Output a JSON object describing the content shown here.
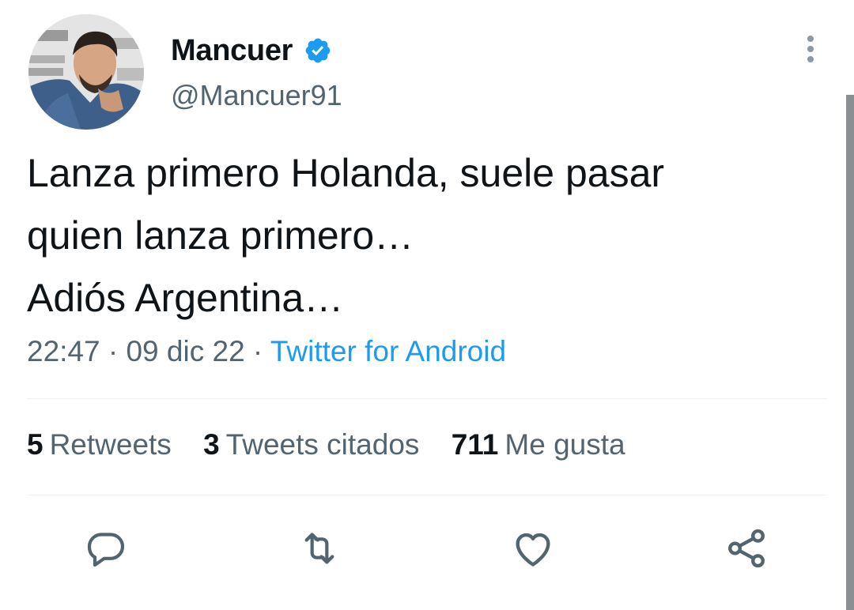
{
  "tweet": {
    "author": {
      "display_name": "Mancuer",
      "handle": "@Mancuer91",
      "verified": true,
      "avatar": "profile-photo"
    },
    "text_lines": [
      "Lanza primero Holanda, suele pasar",
      "quien lanza primero…",
      "Adiós Argentina…"
    ],
    "meta": {
      "time": "22:47",
      "separator": " · ",
      "date": "09 dic 22",
      "source": "Twitter for Android"
    },
    "stats": {
      "retweets": {
        "count": "5",
        "label": "Retweets"
      },
      "quotes": {
        "count": "3",
        "label": "Tweets citados"
      },
      "likes": {
        "count": "711",
        "label": "Me gusta"
      }
    },
    "actions": [
      "reply-icon",
      "retweet-icon",
      "like-icon",
      "share-icon"
    ],
    "colors": {
      "primary_text": "#0f1419",
      "secondary_text": "#536471",
      "link": "#1d9bf0",
      "verified_badge": "#1d9bf0",
      "divider": "#eff3f4"
    }
  }
}
